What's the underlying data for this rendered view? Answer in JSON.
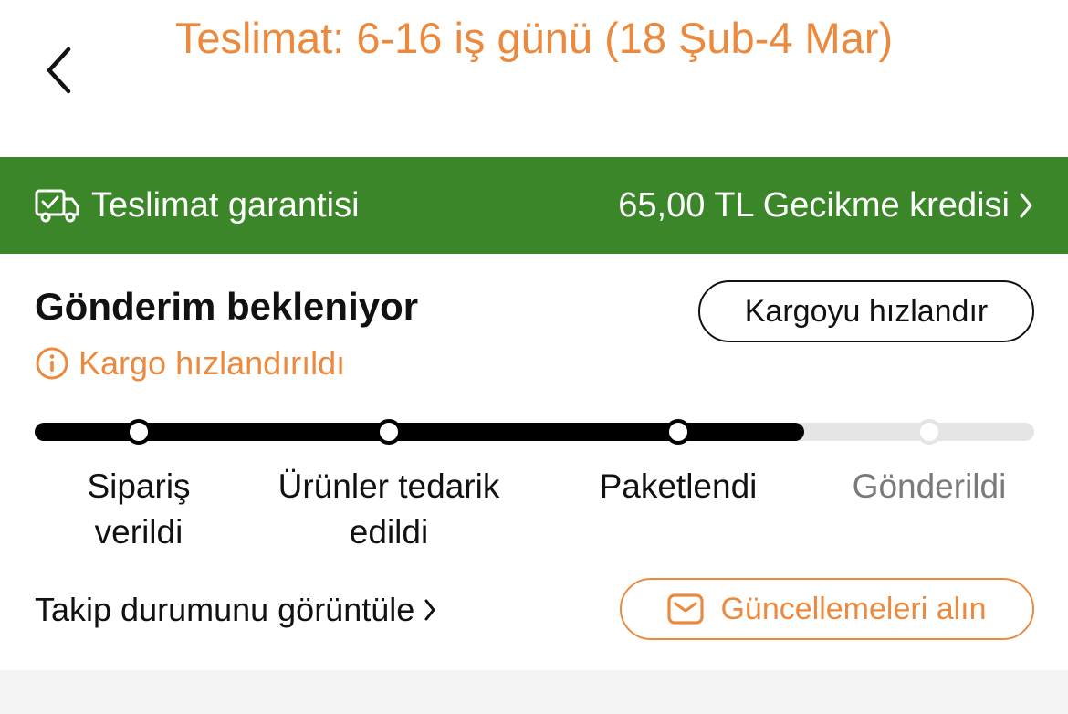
{
  "header": {
    "title": "Teslimat: 6-16 iş günü (18 Şub-4 Mar)",
    "back_icon": "chevron-left-icon"
  },
  "banner": {
    "left_label": "Teslimat garantisi",
    "right_label": "65,00 TL Gecikme kredisi",
    "background_color": "#3A8629",
    "icon": "delivery-truck-check-icon"
  },
  "status": {
    "title": "Gönderim bekleniyor",
    "speed_button_label": "Kargoyu hızlandır",
    "notice_label": "Kargo hızlandırıldı",
    "notice_icon": "info-icon",
    "accent_color": "#EB8A3E"
  },
  "progress": {
    "completed_steps": 3,
    "fill_fraction": 0.77,
    "steps": [
      {
        "label_line1": "Sipariş",
        "label_line2": "verildi",
        "done": true
      },
      {
        "label_line1": "Ürünler tedarik",
        "label_line2": "edildi",
        "done": true
      },
      {
        "label_line1": "Paketlendi",
        "label_line2": "",
        "done": true
      },
      {
        "label_line1": "Gönderildi",
        "label_line2": "",
        "done": false
      }
    ]
  },
  "actions": {
    "track_link_label": "Takip durumunu görüntüle",
    "updates_button_label": "Güncellemeleri alın",
    "updates_icon": "envelope-icon"
  }
}
